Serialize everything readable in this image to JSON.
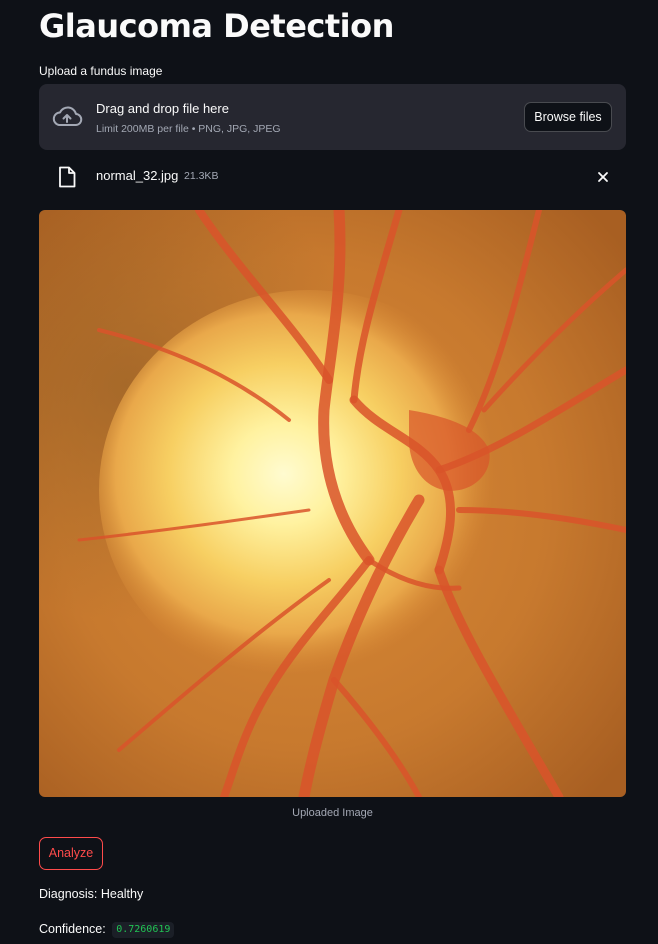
{
  "page": {
    "title": "Glaucoma Detection"
  },
  "uploader": {
    "label": "Upload a fundus image",
    "drop_title": "Drag and drop file here",
    "drop_subtitle": "Limit 200MB per file • PNG, JPG, JPEG",
    "browse_label": "Browse files",
    "icon": "cloud-upload-icon"
  },
  "uploaded_file": {
    "name": "normal_32.jpg",
    "size": "21.3KB",
    "icon": "file-icon",
    "remove_icon": "close-icon"
  },
  "image": {
    "caption": "Uploaded Image"
  },
  "actions": {
    "analyze_label": "Analyze"
  },
  "result": {
    "diagnosis_text": "Diagnosis: Healthy",
    "confidence_label": "Confidence:",
    "confidence_value": "0.7260619"
  },
  "colors": {
    "background": "#0e1117",
    "dropzone": "#262730",
    "accent_red": "#ff4b4b",
    "code_green": "#21c354"
  }
}
